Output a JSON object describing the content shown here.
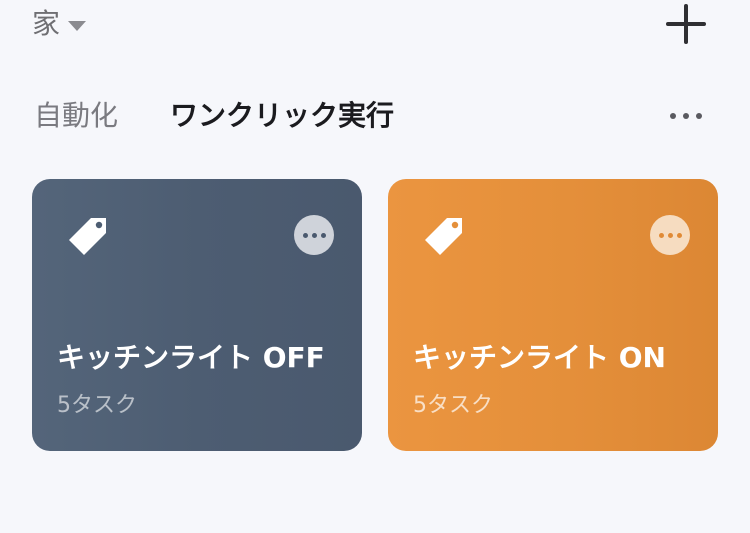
{
  "header": {
    "home_label": "家",
    "home_dropdown_icon": "caret-down-icon",
    "add_icon": "plus-icon"
  },
  "tabs": [
    {
      "label": "自動化",
      "active": false
    },
    {
      "label": "ワンクリック実行",
      "active": true
    }
  ],
  "more_icon": "ellipsis-icon",
  "cards": [
    {
      "title": "キッチンライト OFF",
      "subtitle": "5タスク",
      "icon": "tag-icon",
      "menu_icon": "ellipsis-icon",
      "color": "#4d5d72"
    },
    {
      "title": "キッチンライト ON",
      "subtitle": "5タスク",
      "icon": "tag-icon",
      "menu_icon": "ellipsis-icon",
      "color": "#e48f3a"
    }
  ]
}
